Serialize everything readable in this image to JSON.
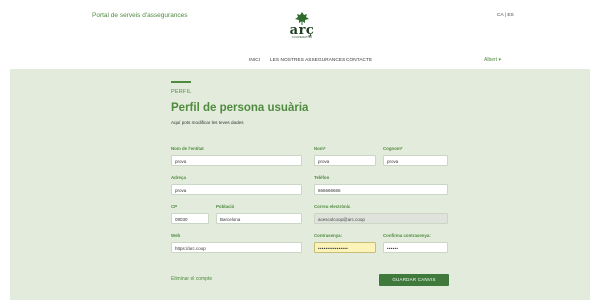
{
  "header": {
    "portal_link": "Portal de serveis d'assegurances",
    "lang_ca": "CA",
    "lang_sep": "|",
    "lang_es": "ES",
    "logo_text": "arç",
    "logo_sub": "COOPERATIVA",
    "nav": [
      "INICI",
      "LES NOSTRES ASSEGURANCES",
      "CONTACTE"
    ],
    "user_menu": "Albert ▾"
  },
  "main": {
    "small_title": "PERFIL",
    "title": "Perfil de persona usuària",
    "subtitle": "Aquí pots modificar les teves dades"
  },
  "form": {
    "entity_name": {
      "label": "Nom de l'entitat",
      "value": "prova"
    },
    "first_name": {
      "label": "Nom*",
      "value": "prova"
    },
    "last_name": {
      "label": "Cognom*",
      "value": "prova"
    },
    "address": {
      "label": "Adreça",
      "value": "prova"
    },
    "phone": {
      "label": "Telèfon",
      "value": "666666666"
    },
    "postal_code": {
      "label": "CP",
      "value": "08030"
    },
    "city": {
      "label": "Població",
      "value": "Barcelona"
    },
    "email": {
      "label": "Correu electrònic",
      "value": "acescolcoop@arc.coop"
    },
    "web": {
      "label": "Web",
      "value": "https://arc.coop"
    },
    "password": {
      "label": "Contrasenya:",
      "value": "••••••••••••••••"
    },
    "confirm_password": {
      "label": "Confirma contrasenya:",
      "value": "••••••"
    }
  },
  "actions": {
    "delete_account": "Eliminar el compte",
    "save": "GUARDAR CANVIS"
  },
  "colors": {
    "accent": "#4f8a3f",
    "background": "#e3ecdc",
    "button": "#3f7a3c",
    "autofill": "#fbf3b8"
  }
}
